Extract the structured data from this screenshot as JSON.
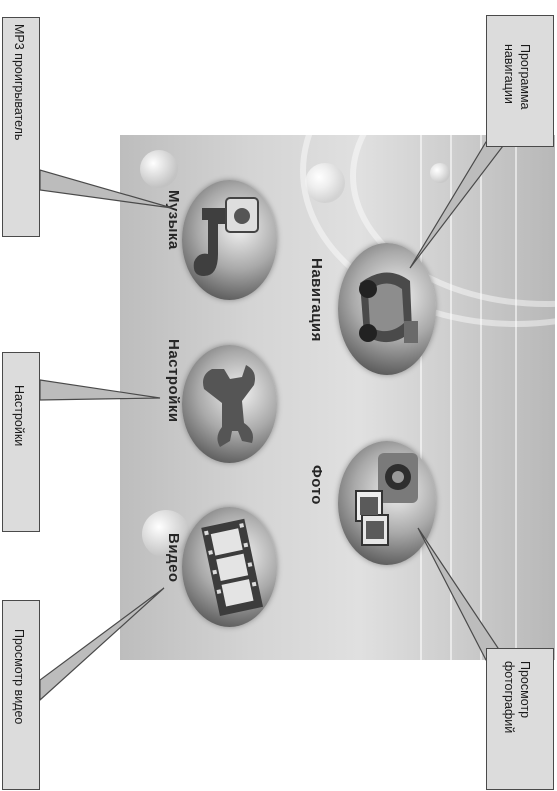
{
  "menu": {
    "navigation": "Навигация",
    "photo": "Фото",
    "music": "Музыка",
    "settings": "Настройки",
    "video": "Видео"
  },
  "callouts": {
    "mp3": "MP3 проигрыватель",
    "settings": "Настройки",
    "video": "Просмотр видео",
    "nav_line1": "Программа",
    "nav_line2": "навигации",
    "photo_line1": "Просмотр",
    "photo_line2": "фотографий"
  },
  "icons": {
    "navigation": "car-icon",
    "photo": "camera-photos-icon",
    "music": "music-note-icon",
    "settings": "wrench-icon",
    "video": "film-strip-icon"
  },
  "colors": {
    "callout_bg": "#dcdcdc",
    "callout_border": "#4a4a4a",
    "label_text": "#262626"
  }
}
